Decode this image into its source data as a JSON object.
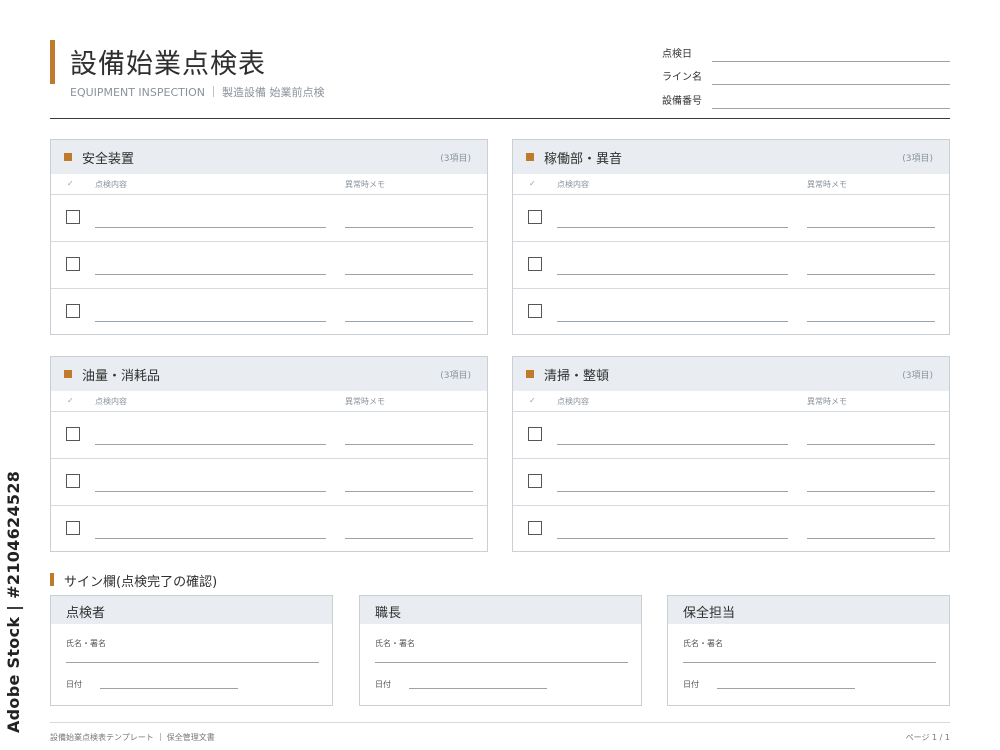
{
  "header": {
    "title": "設備始業点検表",
    "subtitle_en": "EQUIPMENT INSPECTION",
    "subtitle_ja": "製造設備 始業前点検",
    "fields": [
      {
        "label": "点検日"
      },
      {
        "label": "ライン名"
      },
      {
        "label": "設備番号"
      }
    ]
  },
  "columns": {
    "check": "✓",
    "item": "点検内容",
    "memo": "異常時メモ"
  },
  "sections": [
    {
      "title": "安全装置",
      "count": "(3項目)"
    },
    {
      "title": "稼働部・異音",
      "count": "(3項目)"
    },
    {
      "title": "油量・消耗品",
      "count": "(3項目)"
    },
    {
      "title": "清掃・整頓",
      "count": "(3項目)"
    }
  ],
  "sign": {
    "heading": "サイン欄(点検完了の確認)",
    "name_label": "氏名・署名",
    "date_label": "日付",
    "boxes": [
      {
        "title": "点検者"
      },
      {
        "title": "職長"
      },
      {
        "title": "保全担当"
      }
    ]
  },
  "footer": {
    "left_1": "設備始業点検表テンプレート",
    "left_2": "保全管理文書",
    "right": "ページ 1 / 1"
  },
  "watermark": {
    "stock_id": "Adobe Stock | #2104624528"
  },
  "colors": {
    "accent": "#c07a2c",
    "header_fill": "#e9edf1",
    "border": "#c9cfd5"
  }
}
